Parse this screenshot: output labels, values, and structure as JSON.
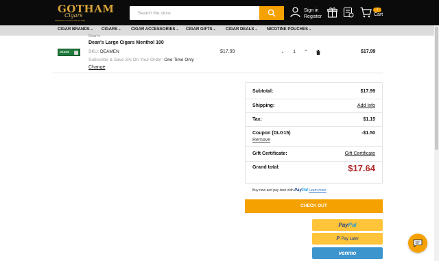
{
  "header": {
    "logo": {
      "main": "GOTHAM",
      "sub": "Cigars",
      "tag": "PREMIUM CIGARS SINCE 1999"
    },
    "search": {
      "placeholder": "Search the store"
    },
    "account": {
      "sign_in": "Sign in",
      "register": "Register"
    },
    "cart": {
      "label": "Cart",
      "count": "1"
    }
  },
  "nav": {
    "items": [
      {
        "label": "CIGAR BRANDS"
      },
      {
        "label": "CIGARS"
      },
      {
        "label": "CIGAR ACCESSORIES"
      },
      {
        "label": "CIGAR GIFTS"
      },
      {
        "label": "CIGAR DEALS"
      },
      {
        "label": "NICOTINE POUCHES"
      }
    ],
    "chevron": "⌄"
  },
  "cart_item": {
    "brand": "Dean's",
    "name": "Dean's Large Cigars Menthol 100",
    "image_text": "DEANS",
    "sku_label": "SKU:",
    "sku": "DEAMEN",
    "subscribe_label": "Subscribe & Save 5% On Your Order:",
    "subscribe_value": "One Time Only",
    "change": "Change",
    "unit_price": "$17.99",
    "quantity": "1",
    "line_total": "$17.99"
  },
  "summary": {
    "subtotal_label": "Subtotal:",
    "subtotal": "$17.99",
    "shipping_label": "Shipping:",
    "shipping_link": "Add Info",
    "tax_label": "Tax:",
    "tax": "$1.15",
    "coupon_label": "Coupon (DLG15)",
    "coupon": "-$1.50",
    "remove": "Remove",
    "gift_label": "Gift Certificate:",
    "gift_link": "Gift Certificate",
    "grand_label": "Grand total:",
    "grand": "$17.64"
  },
  "payment": {
    "paylater_text": "Buy now and pay later with",
    "paypal_a": "Pay",
    "paypal_b": "Pal",
    "learn_more": "Learn more",
    "checkout": "CHECK OUT",
    "paylater_btn": "Pay Later",
    "venmo": "venmo"
  },
  "colors": {
    "accent": "#f5a100",
    "header_bg": "#0b0b0b",
    "grand_total": "#b02a2a"
  }
}
